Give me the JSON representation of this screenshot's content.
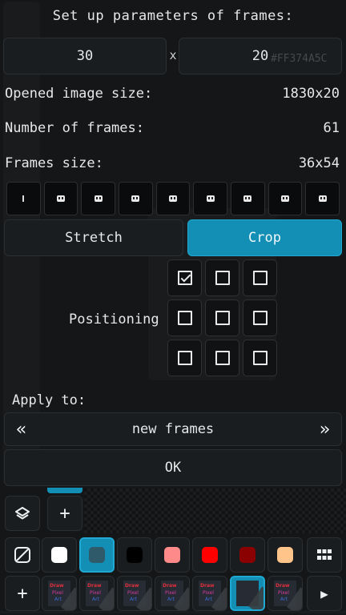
{
  "dialog": {
    "title": "Set up parameters of frames:",
    "width_value": "30",
    "times": "x",
    "height_value": "20",
    "hex_ghost": "#FF374A5C",
    "opened_size_label": "Opened image size:",
    "opened_size_value": "1830x20",
    "frames_count_label": "Number of frames:",
    "frames_count_value": "61",
    "frames_size_label": "Frames size:",
    "frames_size_value": "36x54",
    "stretch_label": "Stretch",
    "crop_label": "Crop",
    "positioning_label": "Positioning",
    "positioning_checked": [
      true,
      false,
      false,
      false,
      false,
      false,
      false,
      false,
      false
    ],
    "apply_to_label": "Apply to:",
    "apply_prev": "«",
    "apply_value": "new frames",
    "apply_next": "»",
    "ok_label": "OK"
  },
  "toolbar": {
    "layers_icon": "layers-icon",
    "add_label": "+",
    "grid_icon": "grid-icon",
    "play_label": "▶"
  },
  "palette": {
    "colors": [
      "#FFFFFF",
      "#2F5A6A",
      "#000000",
      "#FF8A8A",
      "#FF0000",
      "#8B0000",
      "#FFC48A"
    ],
    "selected_index": 1
  },
  "frames": {
    "items": [
      {
        "t1": "Draw",
        "t2": "Pixel",
        "t3": "Art"
      },
      {
        "t1": "Draw",
        "t2": "Pixel",
        "t3": "Art"
      },
      {
        "t1": "Draw",
        "t2": "Pixel",
        "t3": "Art"
      },
      {
        "t1": "Draw",
        "t2": "Pixel",
        "t3": "Art"
      },
      {
        "t1": "Draw",
        "t2": "Pixel",
        "t3": "Art"
      },
      {
        "t1": "",
        "t2": "",
        "t3": ""
      },
      {
        "t1": "Draw",
        "t2": "Pixel",
        "t3": "Art"
      }
    ],
    "selected_index": 5
  }
}
